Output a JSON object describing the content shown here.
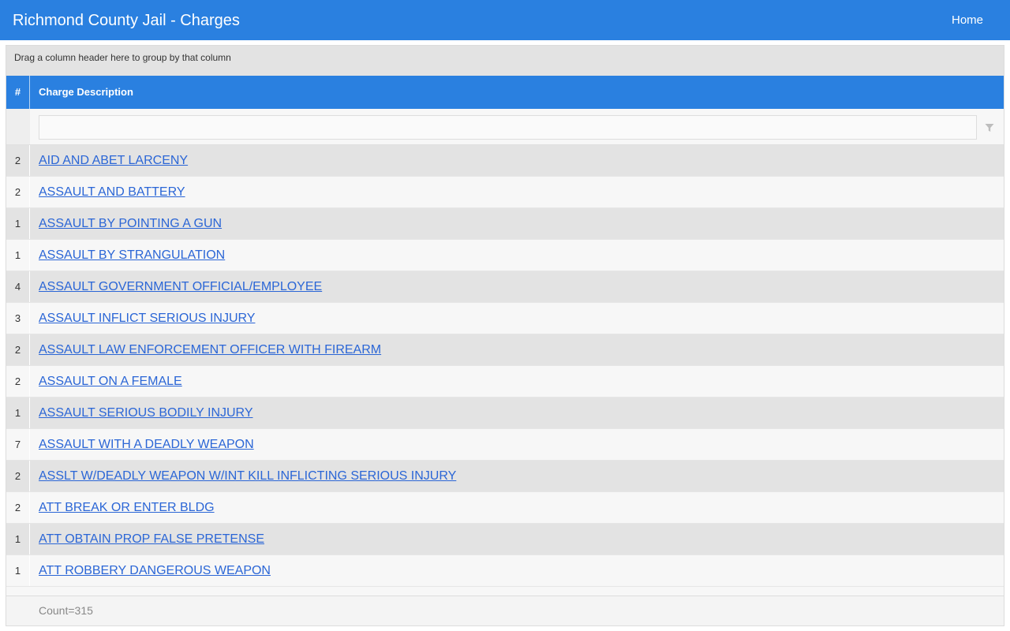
{
  "header": {
    "title": "Richmond County Jail - Charges",
    "home_label": "Home"
  },
  "grid": {
    "group_panel_text": "Drag a column header here to group by that column",
    "columns": {
      "count": "#",
      "description": "Charge Description"
    },
    "filter": {
      "value": "",
      "icon": "filter-icon"
    },
    "rows": [
      {
        "count": "2",
        "description": "AID AND ABET LARCENY"
      },
      {
        "count": "2",
        "description": "ASSAULT AND BATTERY"
      },
      {
        "count": "1",
        "description": "ASSAULT BY POINTING A GUN"
      },
      {
        "count": "1",
        "description": "ASSAULT BY STRANGULATION"
      },
      {
        "count": "4",
        "description": "ASSAULT GOVERNMENT OFFICIAL/EMPLOYEE"
      },
      {
        "count": "3",
        "description": "ASSAULT INFLICT SERIOUS INJURY"
      },
      {
        "count": "2",
        "description": "ASSAULT LAW ENFORCEMENT OFFICER WITH FIREARM"
      },
      {
        "count": "2",
        "description": "ASSAULT ON A FEMALE"
      },
      {
        "count": "1",
        "description": "ASSAULT SERIOUS BODILY INJURY"
      },
      {
        "count": "7",
        "description": "ASSAULT WITH A DEADLY WEAPON"
      },
      {
        "count": "2",
        "description": "ASSLT W/DEADLY WEAPON W/INT KILL INFLICTING SERIOUS INJURY"
      },
      {
        "count": "2",
        "description": "ATT BREAK OR ENTER BLDG"
      },
      {
        "count": "1",
        "description": "ATT OBTAIN PROP FALSE PRETENSE"
      },
      {
        "count": "1",
        "description": "ATT ROBBERY DANGEROUS WEAPON"
      }
    ],
    "footer_summary": "Count=315"
  },
  "colors": {
    "accent": "#2a80e0",
    "link": "#2b66d6",
    "row_alt": "#e3e3e3",
    "row_base": "#f7f7f7"
  }
}
